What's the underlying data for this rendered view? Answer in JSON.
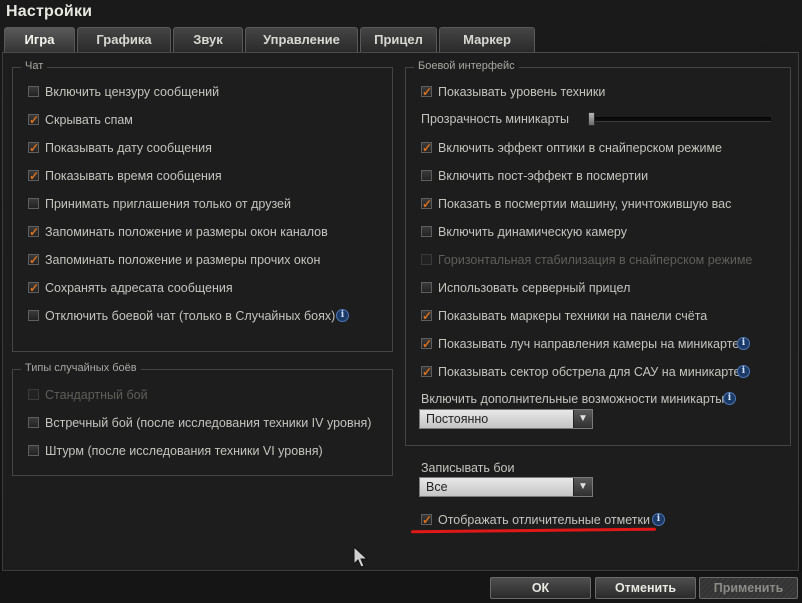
{
  "window": {
    "title": "Настройки"
  },
  "tabs": [
    "Игра",
    "Графика",
    "Звук",
    "Управление",
    "Прицел",
    "Маркер"
  ],
  "chat": {
    "label": "Чат",
    "items": [
      {
        "label": "Включить цензуру сообщений",
        "checked": false
      },
      {
        "label": "Скрывать спам",
        "checked": true
      },
      {
        "label": "Показывать дату сообщения",
        "checked": true
      },
      {
        "label": "Показывать время сообщения",
        "checked": true
      },
      {
        "label": "Принимать приглашения только от друзей",
        "checked": false
      },
      {
        "label": "Запоминать положение и размеры окон каналов",
        "checked": true
      },
      {
        "label": "Запоминать положение и размеры прочих окон",
        "checked": true
      },
      {
        "label": "Сохранять адресата сообщения",
        "checked": true
      },
      {
        "label": "Отключить боевой чат (только в Случайных боях)",
        "checked": false,
        "info": true
      }
    ]
  },
  "battle_types": {
    "label": "Типы случайных боёв",
    "items": [
      {
        "label": "Стандартный бой",
        "checked": false,
        "disabled": true
      },
      {
        "label": "Встречный бой (после исследования техники IV уровня)",
        "checked": false
      },
      {
        "label": "Штурм (после исследования техники VI уровня)",
        "checked": false
      }
    ]
  },
  "battle_ui": {
    "label": "Боевой интерфейс",
    "show_tier": {
      "label": "Показывать уровень техники",
      "checked": true
    },
    "minimap_opacity": {
      "label": "Прозрачность миникарты",
      "value": 0
    },
    "items": [
      {
        "label": "Включить эффект оптики в снайперском режиме",
        "checked": true
      },
      {
        "label": "Включить пост-эффект в посмертии",
        "checked": false
      },
      {
        "label": "Показать в посмертии машину, уничтожившую вас",
        "checked": true
      },
      {
        "label": "Включить динамическую камеру",
        "checked": false
      },
      {
        "label": "Горизонтальная стабилизация в снайперском режиме",
        "checked": false,
        "disabled": true
      },
      {
        "label": "Использовать серверный прицел",
        "checked": false
      },
      {
        "label": "Показывать маркеры техники на панели счёта",
        "checked": true
      },
      {
        "label": "Показывать луч направления камеры на миникарте",
        "checked": true,
        "info": true
      },
      {
        "label": "Показывать сектор обстрела для САУ на миникарте",
        "checked": true,
        "info": true
      }
    ],
    "minimap_extra": {
      "label": "Включить дополнительные возможности миникарты",
      "value": "Постоянно"
    }
  },
  "record": {
    "label": "Записывать бои",
    "value": "Все"
  },
  "marks": {
    "label": "Отображать отличительные отметки",
    "checked": true
  },
  "buttons": {
    "ok": "ОК",
    "cancel": "Отменить",
    "apply": "Применить"
  },
  "colors": {
    "check": "#d87020",
    "highlight": "#e01818",
    "info": "#4d78b8"
  }
}
